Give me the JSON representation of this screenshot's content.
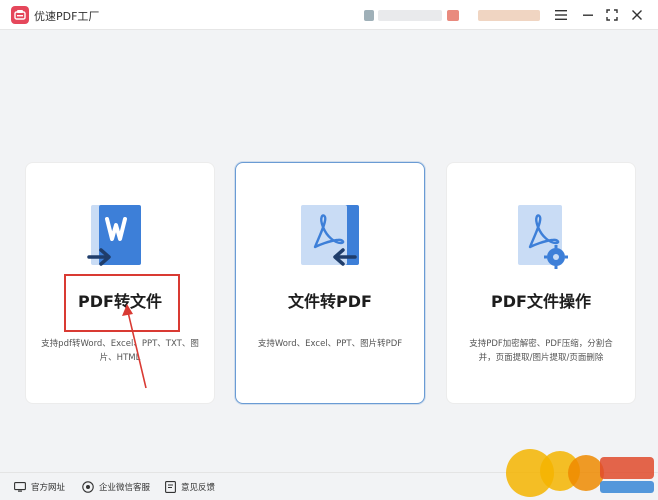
{
  "app": {
    "title": "优速PDF工厂",
    "logo_color": "#e5475b"
  },
  "window_controls": {
    "menu_icon": "hamburger-icon",
    "minimize_icon": "minimize-icon",
    "maximize_icon": "maximize-icon",
    "close_icon": "close-icon"
  },
  "cards": [
    {
      "title": "PDF转文件",
      "description": "支持pdf转Word、Excel、PPT、TXT、图片、HTML",
      "icon": "pdf-to-word-icon"
    },
    {
      "title": "文件转PDF",
      "description": "支持Word、Excel、PPT、图片转PDF",
      "icon": "file-to-pdf-icon"
    },
    {
      "title": "PDF文件操作",
      "description": "支持PDF加密解密、PDF压缩，分割合并，页面提取/图片提取/页面删除",
      "icon": "pdf-settings-icon"
    }
  ],
  "footer": {
    "website": "官方网址",
    "support": "企业微信客服",
    "feedback": "意见反馈"
  },
  "colors": {
    "accent_blue": "#3d7fd8",
    "light_blue": "#c9dcf5",
    "annotation_red": "#d93a33",
    "selected_border": "#6a9bd4"
  }
}
